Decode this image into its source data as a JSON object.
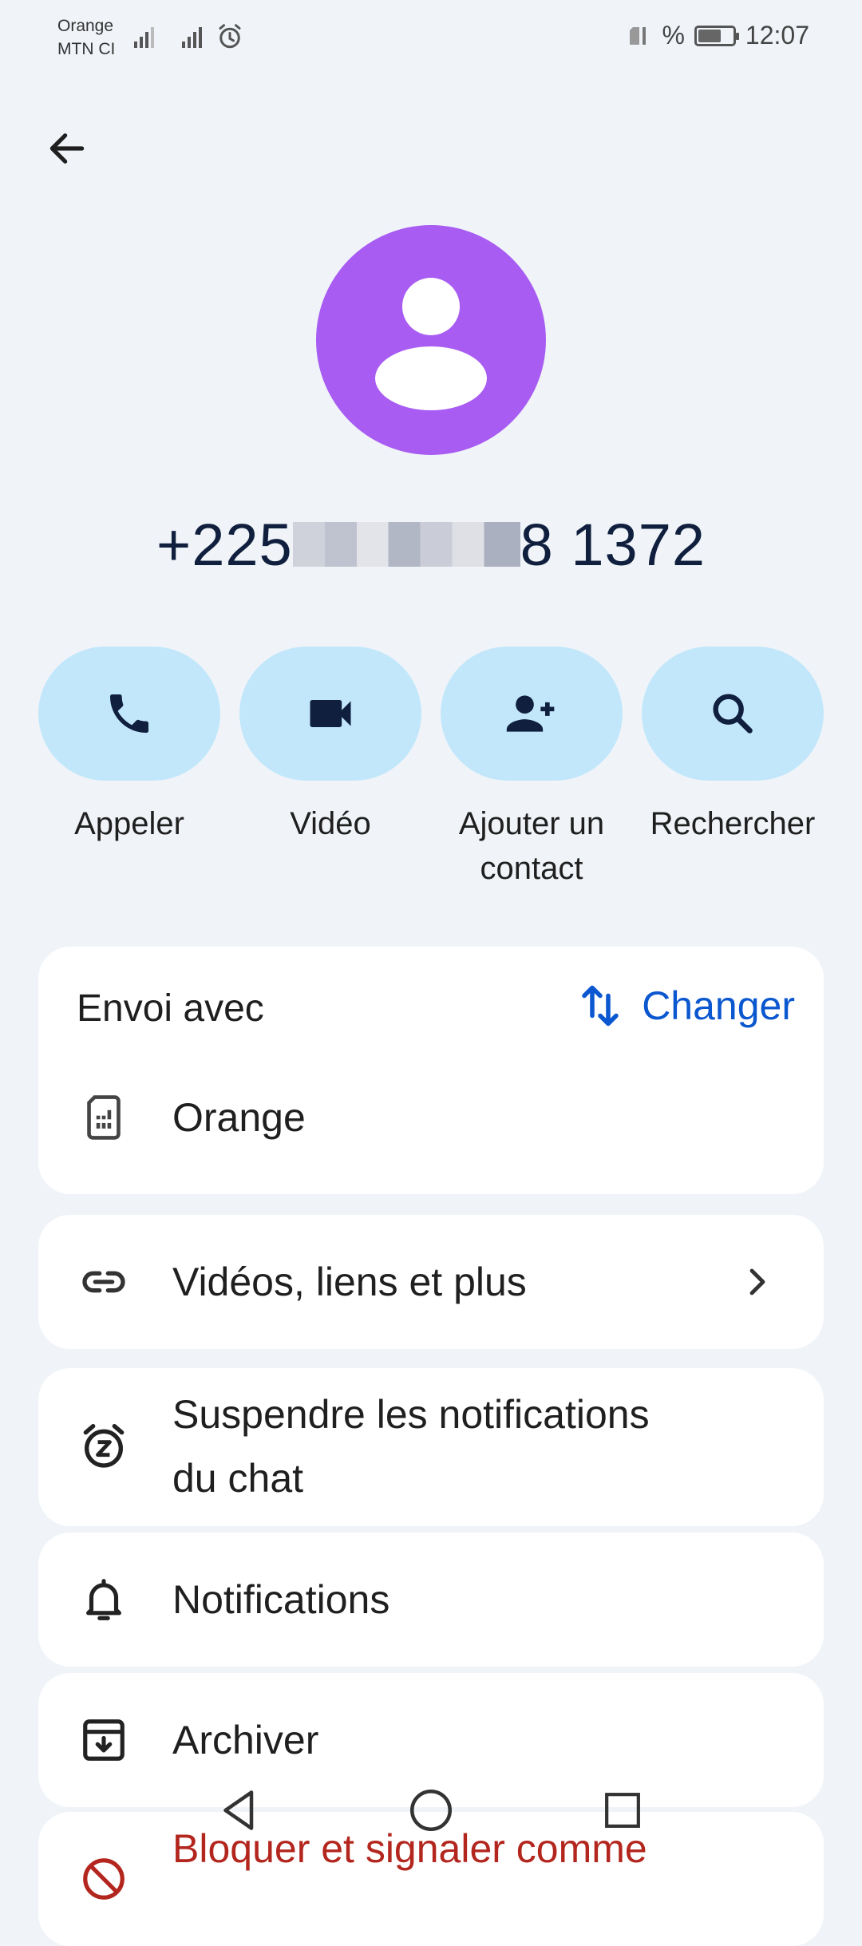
{
  "status_bar": {
    "carrier_1": "Orange",
    "carrier_2": "MTN CI",
    "battery_text": "%",
    "time": "12:07",
    "battery_level": 0.6
  },
  "contact": {
    "phone_prefix": "+225",
    "phone_suffix": "8 1372",
    "avatar_color": "#a85cf2"
  },
  "actions": [
    {
      "label": "Appeler",
      "icon": "phone-icon"
    },
    {
      "label": "Vidéo",
      "icon": "video-icon"
    },
    {
      "label": "Ajouter un contact",
      "icon": "add-person-icon"
    },
    {
      "label": "Rechercher",
      "icon": "search-icon"
    }
  ],
  "send_card": {
    "title": "Envoi avec",
    "change_label": "Changer",
    "sim_name": "Orange"
  },
  "menu": {
    "media_label": "Vidéos, liens et plus",
    "snooze_line1": "Suspendre les notifications",
    "snooze_line2": "du chat",
    "notifications_label": "Notifications",
    "archive_label": "Archiver",
    "block_label": "Bloquer et signaler comme"
  },
  "colors": {
    "accent": "#0b57d0",
    "action_bg": "#c2e7fb",
    "danger": "#b3261e",
    "background": "#f0f4f9"
  }
}
